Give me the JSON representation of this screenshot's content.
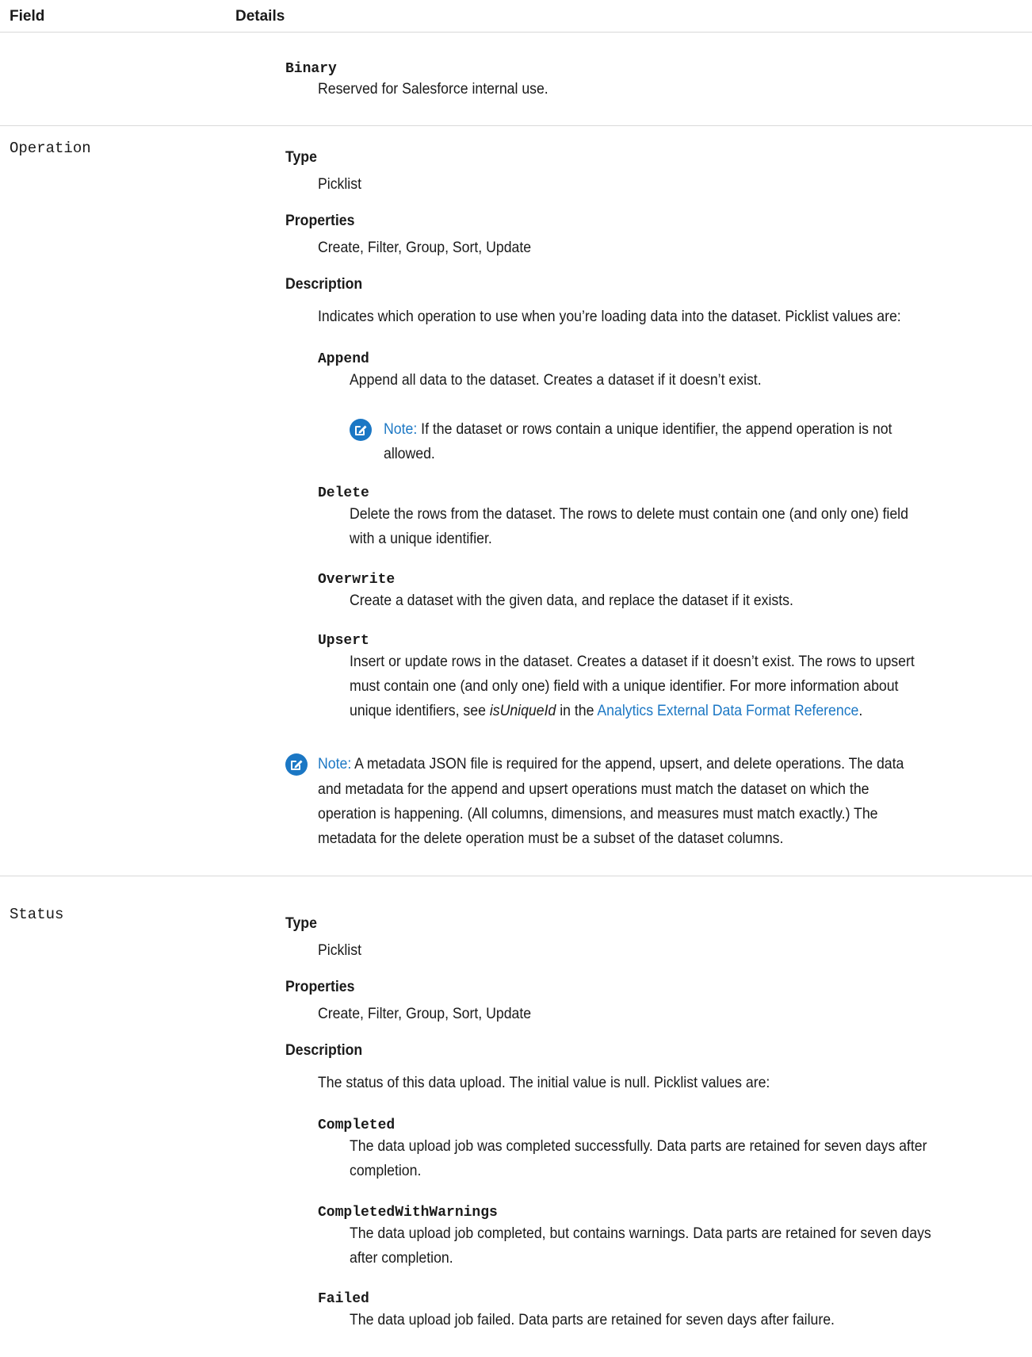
{
  "header": {
    "field": "Field",
    "details": "Details"
  },
  "binary_row": {
    "term": "Binary",
    "desc": "Reserved for Salesforce internal use."
  },
  "operation": {
    "field": "Operation",
    "type_label": "Type",
    "type_value": "Picklist",
    "props_label": "Properties",
    "props_value": "Create, Filter, Group, Sort, Update",
    "desc_label": "Description",
    "desc_intro": "Indicates which operation to use when you’re loading data into the dataset. Picklist values are:",
    "append_term": "Append",
    "append_desc": "Append all data to the dataset. Creates a dataset if it doesn’t exist.",
    "append_note_label": "Note:",
    "append_note_line1": "If the dataset or rows contain a unique identifier, the append operation is not",
    "append_note_line2": "allowed.",
    "delete_term": "Delete",
    "delete_line1": "Delete the rows from the dataset. The rows to delete must contain one (and only one) field",
    "delete_line2": "with a unique identifier.",
    "overwrite_term": "Overwrite",
    "overwrite_desc": "Create a dataset with the given data, and replace the dataset if it exists.",
    "upsert_term": "Upsert",
    "upsert_line1": "Insert or update rows in the dataset. Creates a dataset if it doesn’t exist. The rows to upsert",
    "upsert_line2": "must contain one (and only one) field with a unique identifier. For more information about",
    "upsert_line3_pre": "unique identifiers, see ",
    "upsert_line3_italic": "isUniqueId",
    "upsert_line3_mid": " in the ",
    "upsert_line3_link": "Analytics External Data Format Reference",
    "upsert_line3_end": ".",
    "note_label": "Note:",
    "note_line1": "A metadata JSON file is required for the append, upsert, and delete operations. The data",
    "note_line2": "and metadata for the append and upsert operations must match the dataset on which the",
    "note_line3": "operation is happening. (All columns, dimensions, and measures must match exactly.) The",
    "note_line4": "metadata for the delete operation must be a subset of the dataset columns."
  },
  "status": {
    "field": "Status",
    "type_label": "Type",
    "type_value": "Picklist",
    "props_label": "Properties",
    "props_value": "Create, Filter, Group, Sort, Update",
    "desc_label": "Description",
    "desc_intro": "The status of this data upload. The initial value is null. Picklist values are:",
    "completed_term": "Completed",
    "completed_line1": "The data upload job was completed successfully. Data parts are retained for seven days after",
    "completed_line2": "completion.",
    "cww_term": "CompletedWithWarnings",
    "cww_line1": "The data upload job completed, but contains warnings. Data parts are retained for seven days",
    "cww_line2": "after completion.",
    "failed_term": "Failed",
    "failed_desc": "The data upload job failed. Data parts are retained for seven days after failure."
  },
  "colors": {
    "accent": "#1b77c4",
    "rule": "#d9d9d9"
  },
  "icons": [
    "note-edit-icon"
  ]
}
